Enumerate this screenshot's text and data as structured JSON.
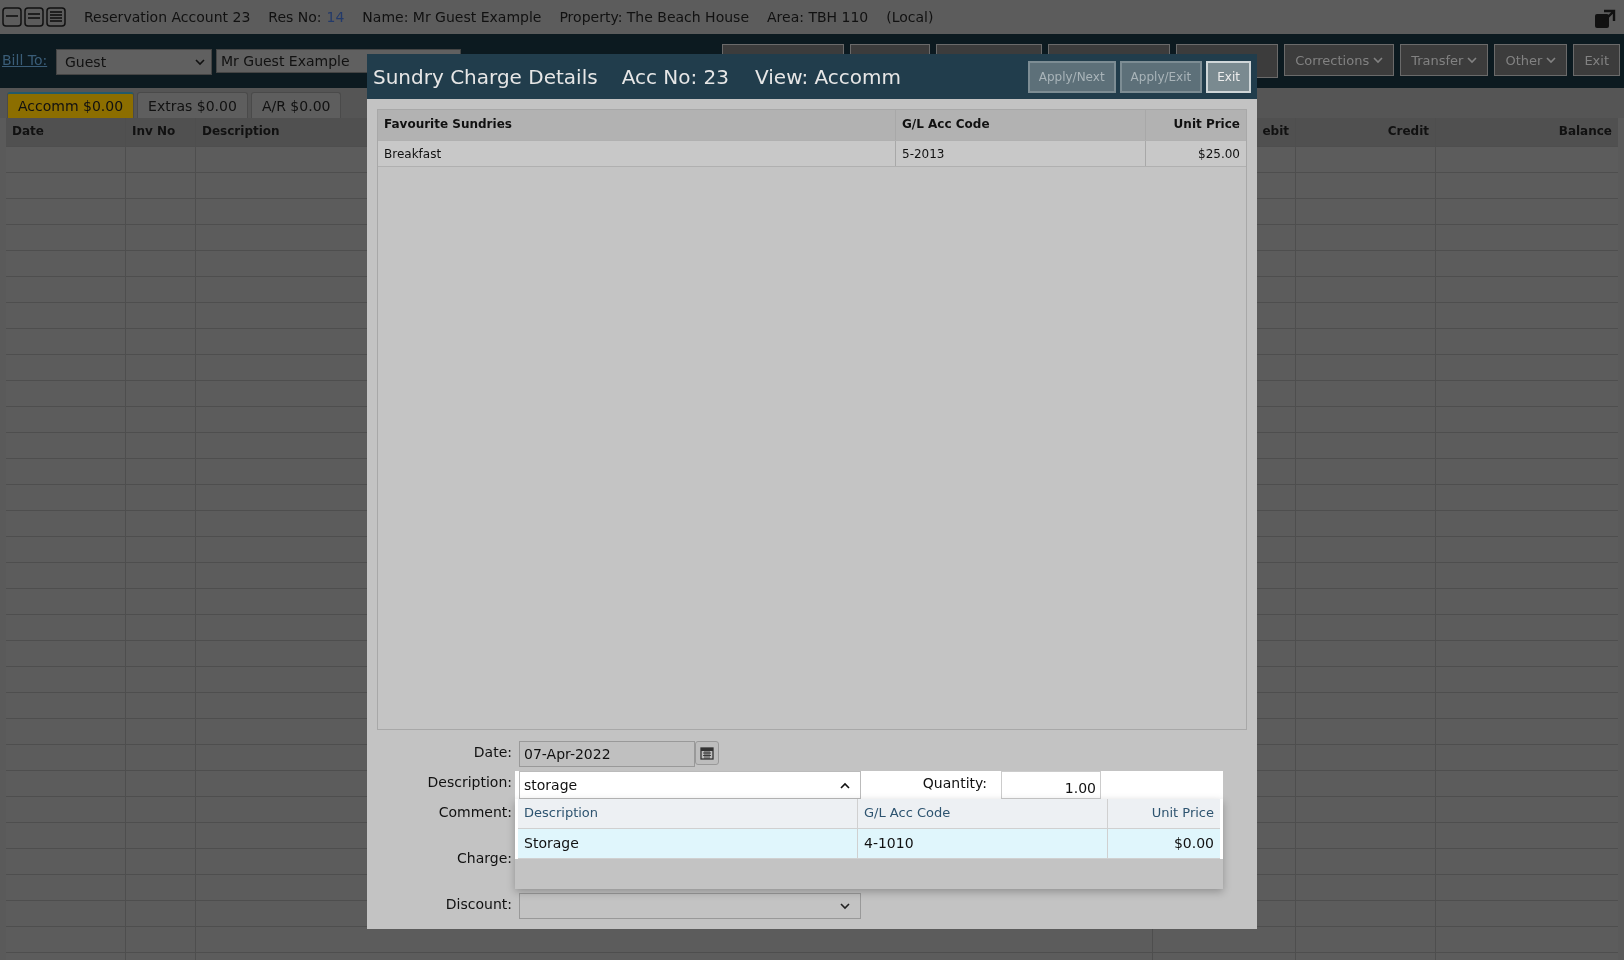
{
  "header": {
    "title": "Reservation Account 23",
    "res_no_label": "Res No:",
    "res_no": "14",
    "name": "Name: Mr Guest Example",
    "property": "Property: The Beach House",
    "area": "Area: TBH 110",
    "local": "(Local)"
  },
  "bill_to": {
    "label": "Bill To:",
    "type": "Guest",
    "name": "Mr Guest Example"
  },
  "toolbar": [
    {
      "label": "Corrections",
      "caret": true
    },
    {
      "label": "Transfer",
      "caret": true
    },
    {
      "label": "Other",
      "caret": true
    },
    {
      "label": "Exit",
      "caret": false
    }
  ],
  "tabs": [
    {
      "label": "Accomm $0.00",
      "selected": true
    },
    {
      "label": "Extras $0.00",
      "selected": false
    },
    {
      "label": "A/R $0.00",
      "selected": false
    }
  ],
  "ledger": {
    "columns": [
      "Date",
      "Inv No",
      "Description",
      "ebit",
      "Credit",
      "Balance"
    ]
  },
  "dialog": {
    "title": "Sundry Charge Details",
    "acc_no": "Acc No: 23",
    "view": "View: Accomm",
    "buttons": [
      {
        "label": "Apply/Next",
        "disabled": true
      },
      {
        "label": "Apply/Exit",
        "disabled": true
      },
      {
        "label": "Exit",
        "disabled": false
      }
    ],
    "favourites": {
      "columns": [
        "Favourite Sundries",
        "G/L Acc Code",
        "Unit Price"
      ],
      "rows": [
        [
          "Breakfast",
          "5-2013",
          "$25.00"
        ]
      ]
    },
    "form": {
      "date_label": "Date:",
      "date": "07-Apr-2022",
      "description_label": "Description:",
      "description": "storage",
      "quantity_label": "Quantity:",
      "quantity": "1.00",
      "comment_label": "Comment:",
      "charge_label": "Charge:",
      "discount_label": "Discount:"
    },
    "dropdown": {
      "expanded": true,
      "columns": [
        "Description",
        "G/L Acc Code",
        "Unit Price"
      ],
      "rows": [
        {
          "cells": [
            "Storage",
            "4-1010",
            "$0.00"
          ],
          "selected": true
        }
      ]
    }
  }
}
